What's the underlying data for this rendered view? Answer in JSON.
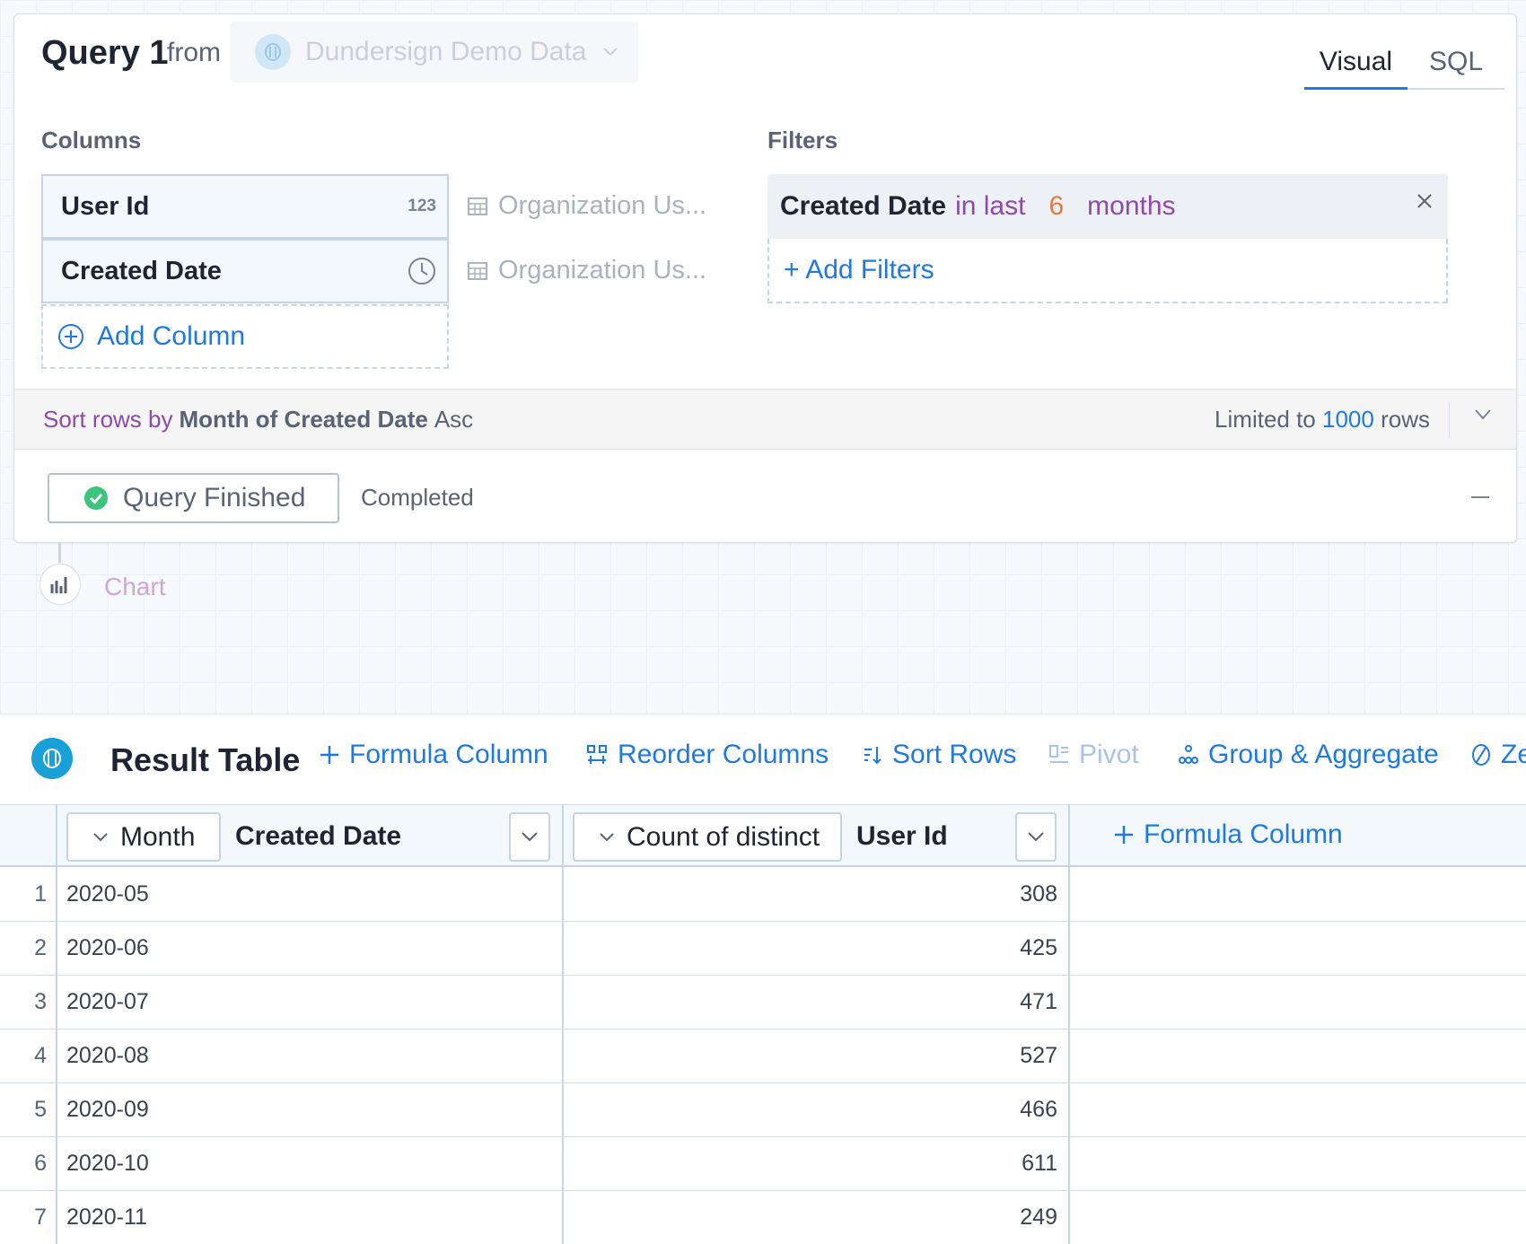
{
  "query": {
    "title": "Query 1",
    "from_label": "from",
    "source": "Dundersign Demo Data",
    "tabs": [
      "Visual",
      "SQL"
    ]
  },
  "columns": {
    "label": "Columns",
    "items": [
      {
        "name": "User Id",
        "type_badge": "123",
        "source": "Organization Us..."
      },
      {
        "name": "Created Date",
        "type_badge": "clock-icon",
        "source": "Organization Us..."
      }
    ],
    "add_label": "Add Column"
  },
  "filters": {
    "label": "Filters",
    "field": "Created Date",
    "operator": "in last",
    "value": "6",
    "unit": "months",
    "add_label": "+ Add Filters"
  },
  "sort": {
    "prefix": "Sort rows by",
    "field": "Month of Created Date",
    "direction": "Asc",
    "limit_prefix": "Limited to",
    "limit_value": "1000",
    "limit_suffix": "rows"
  },
  "status": {
    "button_label": "Query Finished",
    "text": "Completed"
  },
  "chart_node": {
    "label": "Chart"
  },
  "result_table": {
    "title": "Result Table",
    "toolbar": [
      {
        "label": "Formula Column",
        "icon": "plus-icon"
      },
      {
        "label": "Reorder Columns",
        "icon": "reorder-icon"
      },
      {
        "label": "Sort Rows",
        "icon": "sort-icon"
      },
      {
        "label": "Pivot",
        "icon": "pivot-icon"
      },
      {
        "label": "Group & Aggregate",
        "icon": "group-icon"
      },
      {
        "label": "Ze",
        "icon": "zero-icon"
      }
    ],
    "columns": [
      {
        "aggregation": "Month",
        "name": "Created Date"
      },
      {
        "aggregation": "Count of distinct",
        "name": "User Id"
      }
    ],
    "add_column_label": "Formula Column",
    "rows": [
      {
        "n": "1",
        "month": "2020-05",
        "count": "308"
      },
      {
        "n": "2",
        "month": "2020-06",
        "count": "425"
      },
      {
        "n": "3",
        "month": "2020-07",
        "count": "471"
      },
      {
        "n": "4",
        "month": "2020-08",
        "count": "527"
      },
      {
        "n": "5",
        "month": "2020-09",
        "count": "466"
      },
      {
        "n": "6",
        "month": "2020-10",
        "count": "611"
      },
      {
        "n": "7",
        "month": "2020-11",
        "count": "249"
      }
    ]
  },
  "colors": {
    "accent": "#1f7ae0",
    "operator": "#8e4aa8",
    "value": "#e8793f",
    "success": "#3cc47c"
  }
}
